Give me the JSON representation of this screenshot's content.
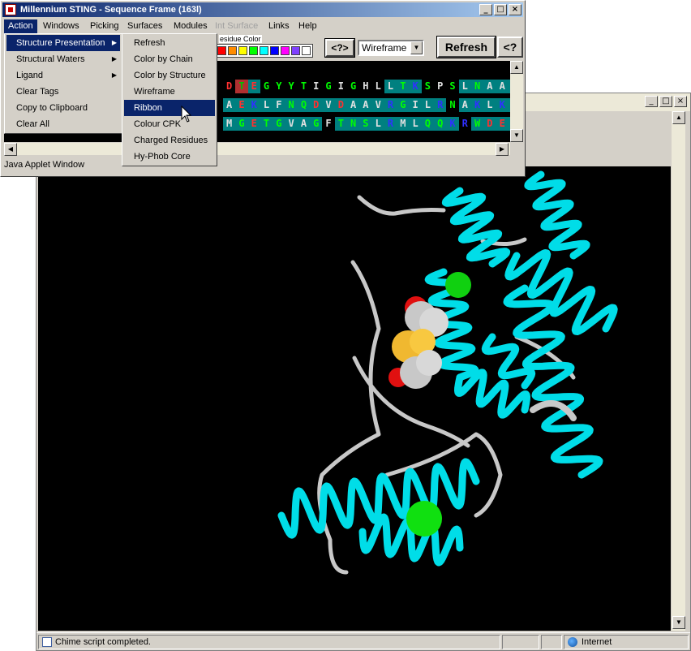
{
  "seq_window": {
    "title": "Millennium STING - Sequence Frame (163l)",
    "menubar": [
      {
        "label": "Action",
        "state": "active"
      },
      {
        "label": "Windows",
        "state": "normal"
      },
      {
        "label": "Picking",
        "state": "normal"
      },
      {
        "label": "Surfaces",
        "state": "normal"
      },
      {
        "label": "Modules",
        "state": "normal"
      },
      {
        "label": "Int Surface",
        "state": "disabled"
      },
      {
        "label": "Links",
        "state": "normal"
      },
      {
        "label": "Help",
        "state": "normal"
      }
    ],
    "toolbar": {
      "residue_color_label": "esidue Color",
      "swatch_colors": [
        "#ff0000",
        "#ff8c00",
        "#ffff00",
        "#00ff00",
        "#00ffff",
        "#0000ff",
        "#ff00ff",
        "#8040ff",
        "#ffffff"
      ],
      "help_button_1": "<?>",
      "render_mode": "Wireframe",
      "refresh_button": "Refresh",
      "help_button_2": "<?"
    },
    "sequence_rows": [
      [
        [
          "D",
          "#ff3030",
          "#000"
        ],
        [
          "T",
          "#00c000",
          "#b03030"
        ],
        [
          "E",
          "#ff3030",
          "#008080"
        ],
        [
          "G",
          "#00ff00",
          "#000"
        ],
        [
          "Y",
          "#00ff00",
          "#000"
        ],
        [
          "Y",
          "#00ff00",
          "#000"
        ],
        [
          "T",
          "#00ff00",
          "#000"
        ],
        [
          "I",
          "#e0e0e0",
          "#000"
        ],
        [
          "G",
          "#00ff00",
          "#000"
        ],
        [
          "I",
          "#e0e0e0",
          "#000"
        ],
        [
          "G",
          "#00ff00",
          "#000"
        ],
        [
          "H",
          "#e0e0e0",
          "#000"
        ],
        [
          "L",
          "#e0e0e0",
          "#000"
        ],
        [
          "L",
          "#e0e0e0",
          "#008080"
        ],
        [
          "T",
          "#00ff00",
          "#008080"
        ],
        [
          "K",
          "#3030ff",
          "#008080"
        ],
        [
          "S",
          "#00ff00",
          "#000"
        ],
        [
          "P",
          "#e0e0e0",
          "#000"
        ],
        [
          "S",
          "#00ff00",
          "#000"
        ],
        [
          "L",
          "#e0e0e0",
          "#008080"
        ],
        [
          "N",
          "#00ff00",
          "#008080"
        ],
        [
          "A",
          "#e0e0e0",
          "#008080"
        ],
        [
          "A",
          "#e0e0e0",
          "#008080"
        ],
        [
          "K",
          "#3030ff",
          "#008080"
        ]
      ],
      [
        [
          "A",
          "#e0e0e0",
          "#008080"
        ],
        [
          "E",
          "#ff3030",
          "#008080"
        ],
        [
          "K",
          "#3030ff",
          "#008080"
        ],
        [
          "L",
          "#e0e0e0",
          "#008080"
        ],
        [
          "F",
          "#e0e0e0",
          "#008080"
        ],
        [
          "N",
          "#00ff00",
          "#008080"
        ],
        [
          "Q",
          "#00ff00",
          "#008080"
        ],
        [
          "D",
          "#ff3030",
          "#008080"
        ],
        [
          "V",
          "#e0e0e0",
          "#008080"
        ],
        [
          "D",
          "#ff3030",
          "#008080"
        ],
        [
          "A",
          "#e0e0e0",
          "#008080"
        ],
        [
          "A",
          "#e0e0e0",
          "#008080"
        ],
        [
          "V",
          "#e0e0e0",
          "#008080"
        ],
        [
          "R",
          "#3030ff",
          "#008080"
        ],
        [
          "G",
          "#00ff00",
          "#008080"
        ],
        [
          "I",
          "#e0e0e0",
          "#008080"
        ],
        [
          "L",
          "#e0e0e0",
          "#008080"
        ],
        [
          "R",
          "#3030ff",
          "#008080"
        ],
        [
          "N",
          "#00ff00",
          "#000"
        ],
        [
          "A",
          "#e0e0e0",
          "#008080"
        ],
        [
          "K",
          "#3030ff",
          "#008080"
        ],
        [
          "L",
          "#e0e0e0",
          "#008080"
        ],
        [
          "K",
          "#3030ff",
          "#008080"
        ],
        [
          "P",
          "#e0e0e0",
          "#008080"
        ]
      ],
      [
        [
          "M",
          "#e0e0e0",
          "#008080"
        ],
        [
          "G",
          "#00ff00",
          "#008080"
        ],
        [
          "E",
          "#ff3030",
          "#008080"
        ],
        [
          "T",
          "#00ff00",
          "#008080"
        ],
        [
          "G",
          "#00ff00",
          "#008080"
        ],
        [
          "V",
          "#e0e0e0",
          "#008080"
        ],
        [
          "A",
          "#e0e0e0",
          "#008080"
        ],
        [
          "G",
          "#00ff00",
          "#008080"
        ],
        [
          "F",
          "#e0e0e0",
          "#000"
        ],
        [
          "T",
          "#00ff00",
          "#008080"
        ],
        [
          "N",
          "#00ff00",
          "#008080"
        ],
        [
          "S",
          "#00ff00",
          "#008080"
        ],
        [
          "L",
          "#e0e0e0",
          "#008080"
        ],
        [
          "R",
          "#3030ff",
          "#008080"
        ],
        [
          "M",
          "#e0e0e0",
          "#008080"
        ],
        [
          "L",
          "#e0e0e0",
          "#008080"
        ],
        [
          "Q",
          "#00ff00",
          "#008080"
        ],
        [
          "Q",
          "#00ff00",
          "#008080"
        ],
        [
          "K",
          "#3030ff",
          "#008080"
        ],
        [
          "R",
          "#3030ff",
          "#000"
        ],
        [
          "W",
          "#00ff00",
          "#008080"
        ],
        [
          "D",
          "#ff3030",
          "#008080"
        ],
        [
          "E",
          "#ff3030",
          "#008080"
        ],
        [
          "A",
          "#e0e0e0",
          "#008080"
        ]
      ]
    ],
    "status_text": "Java Applet Window"
  },
  "action_menu": {
    "items": [
      {
        "label": "Structure Presentation",
        "submenu": true,
        "selected": true
      },
      {
        "label": "Structural Waters",
        "submenu": true,
        "selected": false
      },
      {
        "label": "Ligand",
        "submenu": true,
        "selected": false
      },
      {
        "label": "Clear Tags",
        "submenu": false,
        "selected": false
      },
      {
        "label": "Copy to Clipboard",
        "submenu": false,
        "selected": false
      },
      {
        "label": "Clear All",
        "submenu": false,
        "selected": false
      }
    ]
  },
  "presentation_submenu": {
    "items": [
      {
        "label": "Refresh",
        "selected": false
      },
      {
        "label": "Color by Chain",
        "selected": false
      },
      {
        "label": "Color by Structure",
        "selected": false
      },
      {
        "label": "Wireframe",
        "selected": false
      },
      {
        "label": "Ribbon",
        "selected": true
      },
      {
        "label": "Colour CPK",
        "selected": false
      },
      {
        "label": "Charged Residues",
        "selected": false
      },
      {
        "label": "Hy-Phob Core",
        "selected": false
      }
    ]
  },
  "viewer_window": {
    "status_text": "Chime script completed.",
    "zone_text": "Internet",
    "ribbon_color": "#00dde8",
    "ligand_colors": {
      "carbon": "#c8c8c8",
      "sulfur": "#f0b830",
      "oxygen": "#e01010",
      "ion": "#10e010"
    }
  }
}
